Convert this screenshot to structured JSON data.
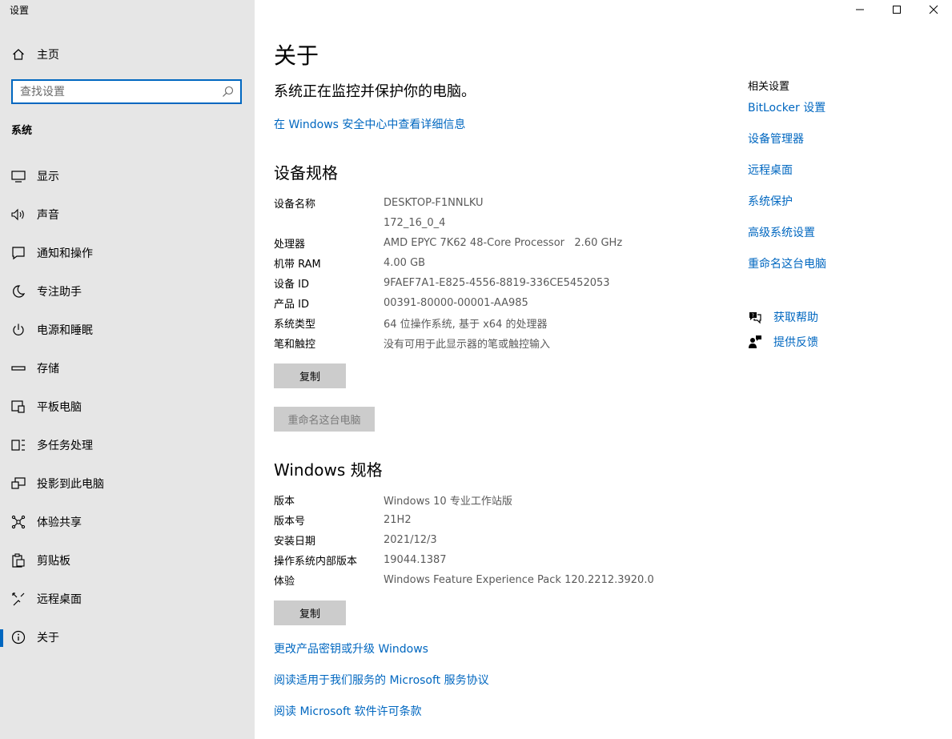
{
  "window": {
    "title": "设置",
    "minimize_icon": "minimize-icon",
    "maximize_icon": "maximize-icon",
    "close_icon": "close-icon"
  },
  "sidebar": {
    "home": "主页",
    "search_placeholder": "查找设置",
    "section": "系统",
    "items": [
      {
        "label": "显示",
        "icon": "display-icon"
      },
      {
        "label": "声音",
        "icon": "speaker-icon"
      },
      {
        "label": "通知和操作",
        "icon": "notification-icon"
      },
      {
        "label": "专注助手",
        "icon": "moon-icon"
      },
      {
        "label": "电源和睡眠",
        "icon": "power-icon"
      },
      {
        "label": "存储",
        "icon": "storage-icon"
      },
      {
        "label": "平板电脑",
        "icon": "tablet-icon"
      },
      {
        "label": "多任务处理",
        "icon": "multitask-icon"
      },
      {
        "label": "投影到此电脑",
        "icon": "project-icon"
      },
      {
        "label": "体验共享",
        "icon": "share-icon"
      },
      {
        "label": "剪贴板",
        "icon": "clipboard-icon"
      },
      {
        "label": "远程桌面",
        "icon": "remote-icon"
      },
      {
        "label": "关于",
        "icon": "info-icon"
      }
    ],
    "active_index": 12,
    "accent_color": "#0067c0"
  },
  "main": {
    "title": "关于",
    "protect_text": "系统正在监控并保护你的电脑。",
    "security_link": "在 Windows 安全中心中查看详细信息",
    "device_specs": {
      "heading": "设备规格",
      "rows": [
        {
          "key": "设备名称",
          "value": "DESKTOP-F1NNLKU"
        },
        {
          "key": "",
          "value": "172_16_0_4"
        },
        {
          "key": "处理器",
          "value": "AMD EPYC 7K62 48-Core Processor   2.60 GHz"
        },
        {
          "key": "机带 RAM",
          "value": "4.00 GB"
        },
        {
          "key": "设备 ID",
          "value": "9FAEF7A1-E825-4556-8819-336CE5452053"
        },
        {
          "key": "产品 ID",
          "value": "00391-80000-00001-AA985"
        },
        {
          "key": "系统类型",
          "value": "64 位操作系统, 基于 x64 的处理器"
        },
        {
          "key": "笔和触控",
          "value": "没有可用于此显示器的笔或触控输入"
        }
      ],
      "copy_button": "复制",
      "rename_button": "重命名这台电脑"
    },
    "windows_specs": {
      "heading": "Windows 规格",
      "rows": [
        {
          "key": "版本",
          "value": "Windows 10 专业工作站版"
        },
        {
          "key": "版本号",
          "value": "21H2"
        },
        {
          "key": "安装日期",
          "value": "2021/12/3"
        },
        {
          "key": "操作系统内部版本",
          "value": "19044.1387"
        },
        {
          "key": "体验",
          "value": "Windows Feature Experience Pack 120.2212.3920.0"
        }
      ],
      "copy_button": "复制"
    },
    "links": [
      "更改产品密钥或升级 Windows",
      "阅读适用于我们服务的 Microsoft 服务协议",
      "阅读 Microsoft 软件许可条款"
    ]
  },
  "related": {
    "title": "相关设置",
    "links": [
      "BitLocker 设置",
      "设备管理器",
      "远程桌面",
      "系统保护",
      "高级系统设置",
      "重命名这台电脑"
    ],
    "help": {
      "label": "获取帮助",
      "icon": "help-chat-icon"
    },
    "feedback": {
      "label": "提供反馈",
      "icon": "feedback-icon"
    },
    "link_color": "#0067c0"
  }
}
